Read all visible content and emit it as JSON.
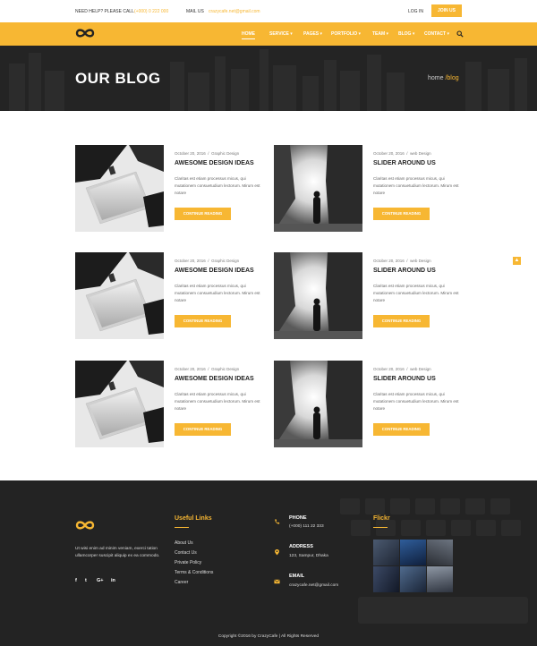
{
  "topbar": {
    "help_label": "NEED HELP? PLEASE CALL",
    "phone": "(+000) 0 222 000",
    "mail_label": "MAIL US",
    "email": "crazycafe.net@gmail.com",
    "login": "LOG IN",
    "join": "JOIN US"
  },
  "nav": {
    "items": [
      {
        "label": "HOME",
        "active": true
      },
      {
        "label": "SERVICE ▾"
      },
      {
        "label": "PAGES ▾"
      },
      {
        "label": "PORTFOLIO ▾"
      },
      {
        "label": "TEAM ▾"
      },
      {
        "label": "BLOG ▾"
      },
      {
        "label": "CONTACT ▾"
      }
    ],
    "search_icon": "search-icon"
  },
  "hero": {
    "title": "OUR BLOG",
    "crumb_home": "home",
    "crumb_current": " /blog"
  },
  "posts": [
    {
      "date": "October 20, 2016",
      "sep": "/",
      "category": "Graphic Design",
      "title": "AWESOME DESIGN IDEAS",
      "excerpt": "Claritas est etiam processus micus, qui mutationem consuetudium lectorum. Mirum est notare",
      "button": "CONTINUE READING",
      "image": "keyboard-photo"
    },
    {
      "date": "October 20, 2016",
      "sep": "/",
      "category": "web Design",
      "title": "SLIDER AROUND US",
      "excerpt": "Claritas est etiam processus micus, qui mutationem consuetudium lectorum. Mirum est notare",
      "button": "CONTINUE READING",
      "image": "street-photo"
    },
    {
      "date": "October 20, 2016",
      "sep": "/",
      "category": "Graphic Design",
      "title": "AWESOME DESIGN IDEAS",
      "excerpt": "Claritas est etiam processus micus, qui mutationem consuetudium lectorum. Mirum est notare",
      "button": "CONTINUE READING",
      "image": "keyboard-photo"
    },
    {
      "date": "October 20, 2016",
      "sep": "/",
      "category": "web Design",
      "title": "SLIDER AROUND US",
      "excerpt": "Claritas est etiam processus micus, qui mutationem consuetudium lectorum. Mirum est notare",
      "button": "CONTINUE READING",
      "image": "street-photo"
    },
    {
      "date": "October 20, 2016",
      "sep": "/",
      "category": "Graphic Design",
      "title": "AWESOME DESIGN IDEAS",
      "excerpt": "Claritas est etiam processus micus, qui mutationem consuetudium lectorum. Mirum est notare",
      "button": "CONTINUE READING",
      "image": "keyboard-photo"
    },
    {
      "date": "October 20, 2016",
      "sep": "/",
      "category": "web Design",
      "title": "SLIDER AROUND US",
      "excerpt": "Claritas est etiam processus micus, qui mutationem consuetudium lectorum. Mirum est notare",
      "button": "CONTINUE READING",
      "image": "street-photo"
    }
  ],
  "scroll_top_icon": "chevron-up-icon",
  "footer": {
    "about": "Ut wisi enim ad minim veniam, exerci tation ullamcorper suscipit aliquip ex ea commodo.",
    "social": [
      "f",
      "t",
      "G+",
      "in"
    ],
    "useful_title": "Useful Links",
    "links": [
      "About Us",
      "Contact Us",
      "Private Policy",
      "Terms & Conditions",
      "Career"
    ],
    "contact": [
      {
        "label": "PHONE",
        "value": "(+000) 111 22 333",
        "icon": "phone-icon"
      },
      {
        "label": "ADDRESS",
        "value": "123, Sampur, Dhaka",
        "icon": "location-pin-icon"
      },
      {
        "label": "EMAIL",
        "value": "crazycafe.net@gmail.com",
        "icon": "envelope-icon"
      }
    ],
    "flickr_title": "Flickr",
    "copyright": "Copyright ©2016 by CrazyCafe  |  All Rights Reserved"
  },
  "colors": {
    "accent": "#f7b733",
    "dark": "#222222"
  }
}
